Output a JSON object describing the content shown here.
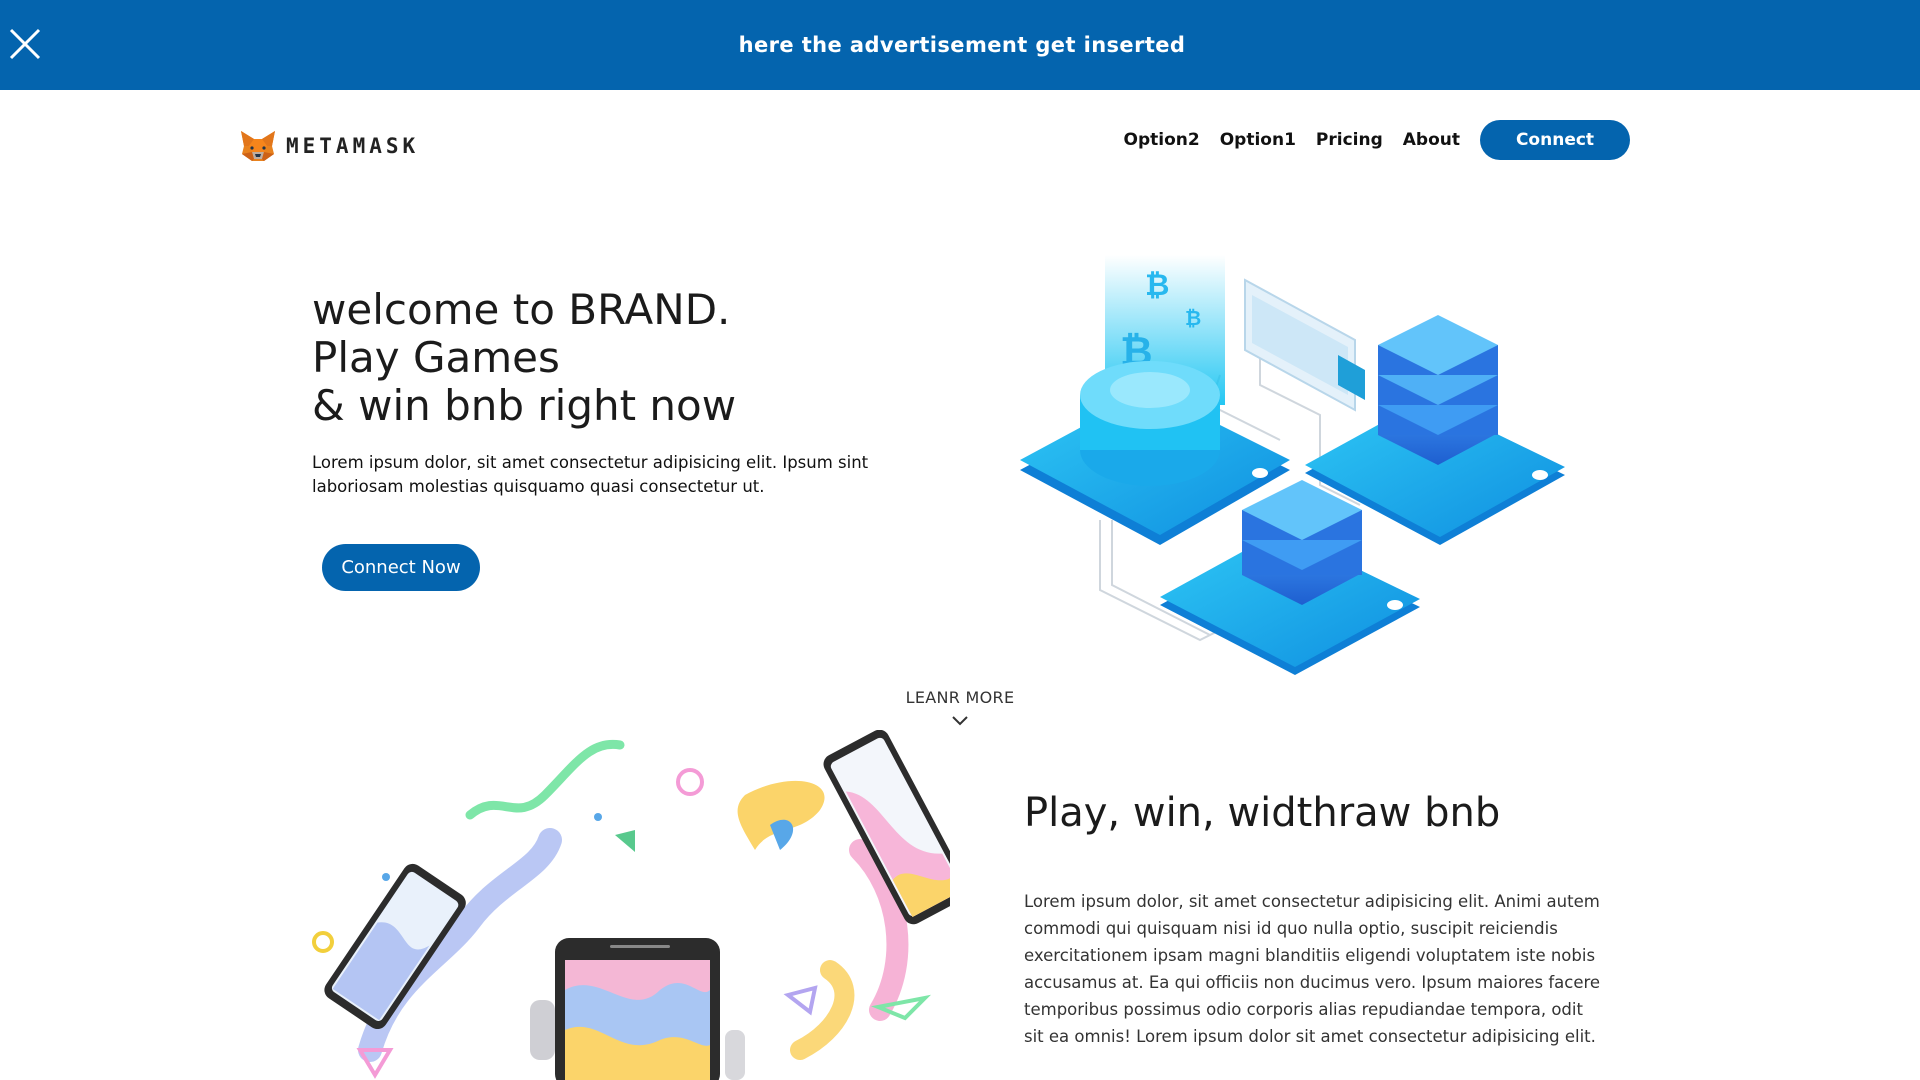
{
  "ad": {
    "text": "here the advertisement get inserted",
    "close_icon": "close-icon"
  },
  "brand": {
    "name": "METAMASK",
    "logo_icon": "fox-icon"
  },
  "nav": {
    "items": [
      "Option2",
      "Option1",
      "Pricing",
      "About"
    ],
    "connect_label": "Connect"
  },
  "hero": {
    "title_lines": [
      "welcome to BRAND.",
      "Play Games",
      "& win bnb right now"
    ],
    "description": "Lorem ipsum dolor, sit amet consectetur adipisicing elit. Ipsum sint laboriosam molestias quisquamo quasi consectetur ut.",
    "cta_label": "Connect Now",
    "illustration": "isometric-crypto-servers-illustration"
  },
  "learn_more": {
    "label": "LEANR MORE",
    "icon": "chevron-down-icon"
  },
  "section2": {
    "title": "Play, win, widthraw bnb",
    "description": "Lorem ipsum dolor, sit amet consectetur adipisicing elit. Animi autem commodi qui quisquam nisi id quo nulla optio, suscipit reiciendis exercitationem ipsam magni blanditiis eligendi voluptatem iste nobis accusamus at. Ea qui officiis non ducimus vero. Ipsum maiores facere temporibus possimus odio corporis alias repudiandae tempora, odit sit ea omnis! Lorem ipsum dolor sit amet consectetur adipisicing elit.",
    "illustration": "floating-phones-illustration"
  },
  "colors": {
    "primary": "#0464ae",
    "text": "#1b1b1b",
    "accent_cyan": "#1fb6f0"
  }
}
